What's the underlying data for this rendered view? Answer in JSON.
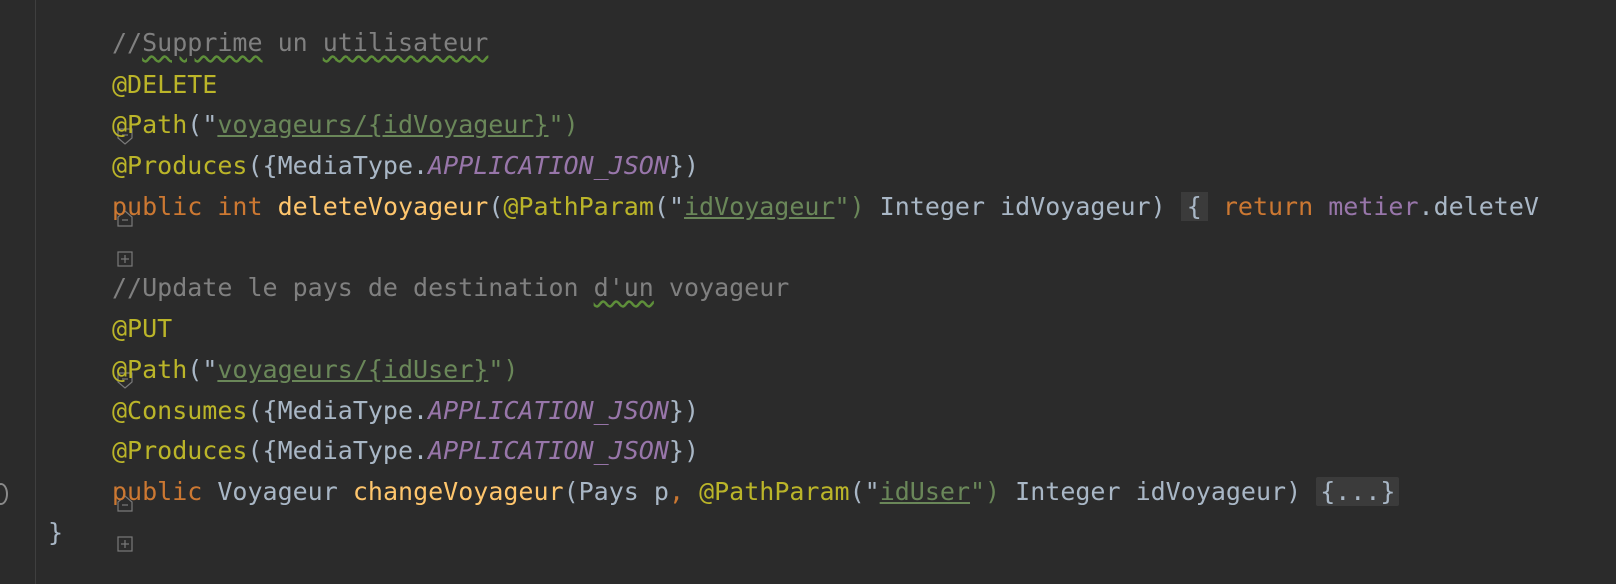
{
  "editor": {
    "lines": [
      {
        "comment_prefix": "//",
        "comment_word1": "Supprime",
        "comment_mid": " un ",
        "comment_word2": "utilisateur"
      },
      {
        "annotation": "@DELETE"
      },
      {
        "annotation": "@Path",
        "open": "(\"",
        "path": "voyageurs/{idVoyageur}",
        "close": "\")"
      },
      {
        "annotation": "@Produces",
        "open": "({MediaType.",
        "constant": "APPLICATION_JSON",
        "close": "})"
      },
      {
        "kw_public": "public",
        "kw_type": "int",
        "method": "deleteVoyageur",
        "paren_open": "(",
        "param_ann": "@PathParam",
        "param_open": "(\"",
        "param_value": "idVoyageur",
        "param_close": "\")",
        "param_rest": " Integer idVoyageur)",
        "brace": "{",
        "kw_return": "return",
        "field": "metier",
        "call": ".deleteV"
      },
      {
        "empty": ""
      },
      {
        "comment_prefix": "//Update le pays de destination ",
        "comment_word": "d'un",
        "comment_suffix": " voyageur"
      },
      {
        "annotation": "@PUT"
      },
      {
        "annotation": "@Path",
        "open": "(\"",
        "path": "voyageurs/{idUser}",
        "close": "\")"
      },
      {
        "annotation": "@Consumes",
        "open": "({MediaType.",
        "constant": "APPLICATION_JSON",
        "close": "})"
      },
      {
        "annotation": "@Produces",
        "open": "({MediaType.",
        "constant": "APPLICATION_JSON",
        "close": "})"
      },
      {
        "kw_public": "public",
        "type": "Voyageur",
        "method": "changeVoyageur",
        "params_start": "(Pays p",
        "comma": ",",
        "param_ann": "@PathParam",
        "param_open": "(\"",
        "param_value": "idUser",
        "param_close": "\")",
        "param_rest": " Integer idVoyageur)",
        "folded": "{...}"
      },
      {
        "closing_brace": "}"
      }
    ]
  }
}
